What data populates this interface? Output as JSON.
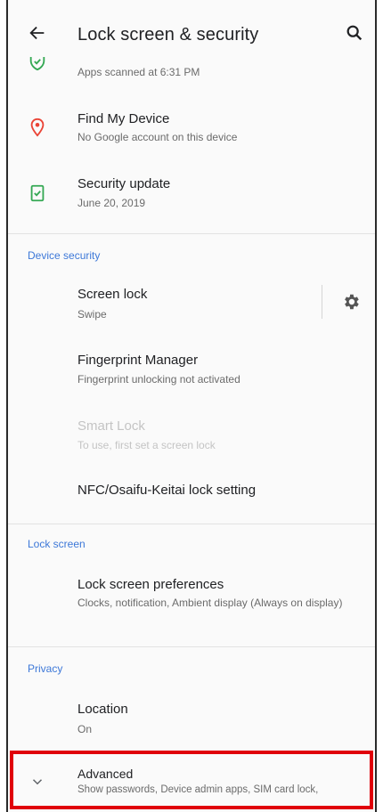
{
  "appbar": {
    "title": "Lock screen & security",
    "back_icon": "arrow-back-icon",
    "search_icon": "search-icon"
  },
  "items": {
    "play_protect": {
      "summary": "Apps scanned at 6:31 PM",
      "icon": "shield-check-icon",
      "icon_color": "#34a853"
    },
    "find_my_device": {
      "title": "Find My Device",
      "summary": "No Google account on this device",
      "icon": "location-pin-icon",
      "icon_color": "#ea4335"
    },
    "security_update": {
      "title": "Security update",
      "summary": "June 20, 2019",
      "icon": "security-update-icon",
      "icon_color": "#34a853"
    }
  },
  "device_security": {
    "header": "Device security",
    "screen_lock": {
      "title": "Screen lock",
      "summary": "Swipe"
    },
    "fingerprint": {
      "title": "Fingerprint Manager",
      "summary": "Fingerprint unlocking not activated"
    },
    "smart_lock": {
      "title": "Smart Lock",
      "summary": "To use, first set a screen lock"
    },
    "nfc_lock": {
      "title": "NFC/Osaifu-Keitai lock setting"
    }
  },
  "lock_screen": {
    "header": "Lock screen",
    "preferences": {
      "title": "Lock screen preferences",
      "summary": "Clocks, notification, Ambient display (Always on display)"
    }
  },
  "privacy": {
    "header": "Privacy",
    "location": {
      "title": "Location",
      "summary": "On"
    },
    "advanced": {
      "title": "Advanced",
      "summary": "Show passwords, Device admin apps, SIM card lock,",
      "icon": "chevron-down-icon"
    }
  },
  "colors": {
    "accent": "#3d78d8",
    "highlight": "#e0000b"
  }
}
